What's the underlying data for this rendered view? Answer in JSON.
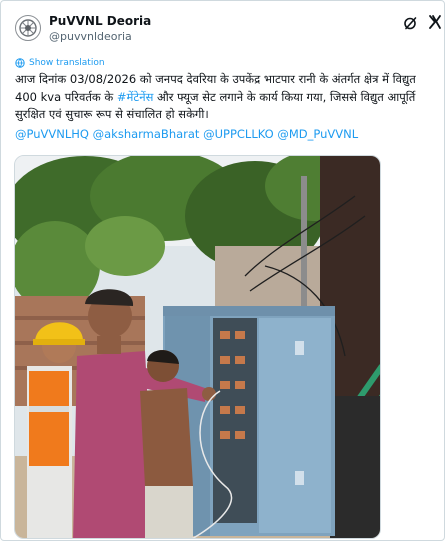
{
  "post": {
    "author_name": "PuVVNL Deoria",
    "author_handle": "@puvvnldeoria",
    "translate_label": "Show translation",
    "text_part1": "आज दिनांक 03/08/2026 को जनपद देवरिया के उपकेंद्र भाटपार रानी के अंतर्गत क्षेत्र में  विद्युत 400 kva परिवर्तक के ",
    "hashtag": "#मेंटेनेंस",
    "text_part2": " और फ्यूज सेट लगाने के कार्य किया गया, जिससे विद्युत आपूर्ति सुरक्षित एवं सुचारू रूप से संचालित हो सकेगी।",
    "mentions": "@PuVVNLHQ @aksharmaBharat @UPPCLLKO @MD_PuVVNL"
  },
  "icons": {
    "avatar": "puvvnl-logo-avatar",
    "x_logo": "x-logo-icon",
    "grok": "grok-icon",
    "translate": "globe-icon"
  },
  "colors": {
    "link": "#1d9bf0",
    "text": "#0f1419",
    "muted": "#536471"
  }
}
